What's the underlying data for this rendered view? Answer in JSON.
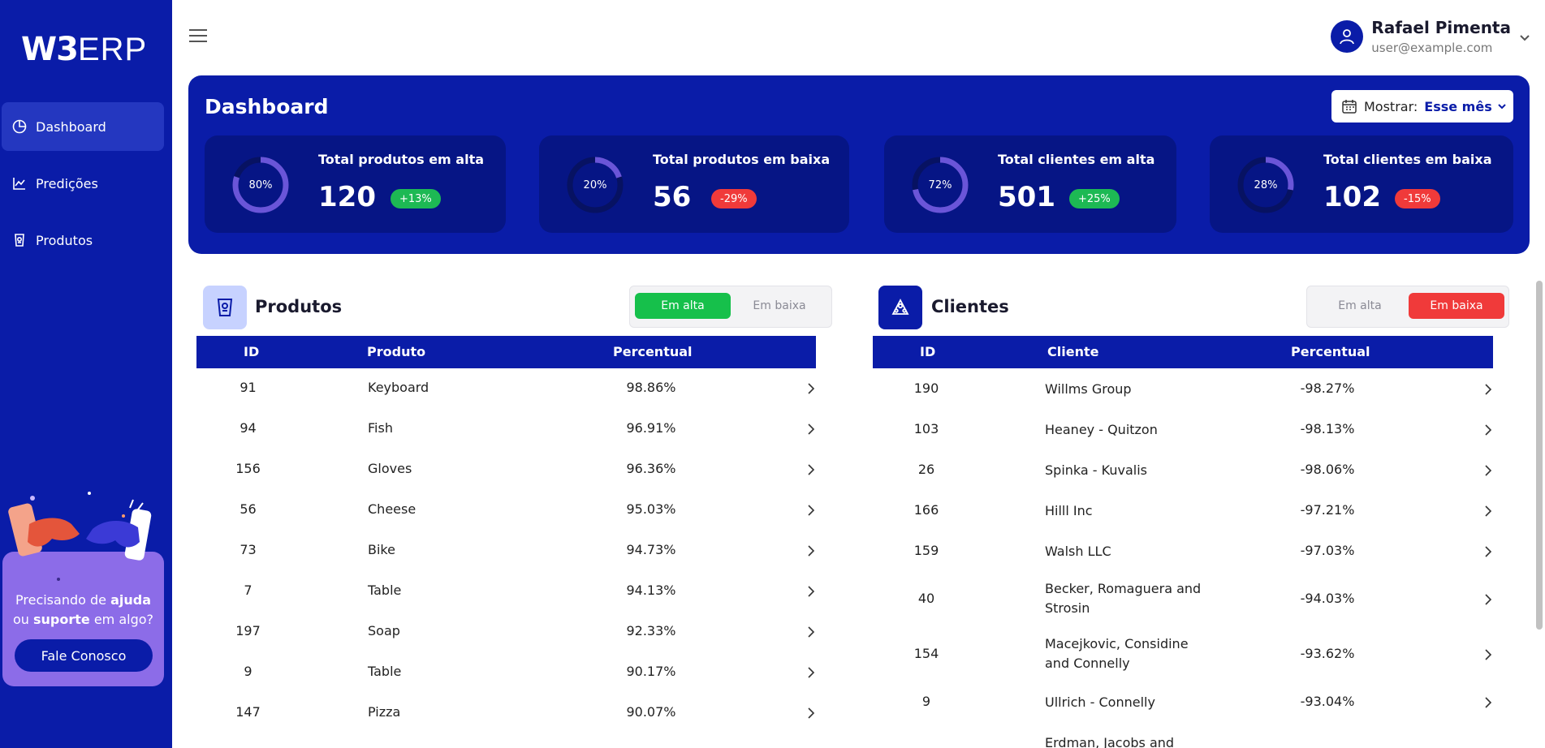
{
  "logo": {
    "w3": "W3",
    "erp": "ERP"
  },
  "sidebar": {
    "items": [
      {
        "label": "Dashboard",
        "icon": "pie-chart-icon",
        "active": true
      },
      {
        "label": "Predições",
        "icon": "line-chart-icon",
        "active": false
      },
      {
        "label": "Produtos",
        "icon": "product-icon",
        "active": false
      }
    ],
    "help": {
      "line1_pre": "Precisando de ",
      "line1_bold": "ajuda",
      "line2_pre": "ou ",
      "line2_bold": "suporte",
      "line2_post": " em algo?",
      "button": "Fale Conosco"
    }
  },
  "user": {
    "name": "Rafael Pimenta",
    "email": "user@example.com"
  },
  "dashboard": {
    "title": "Dashboard",
    "filter": {
      "label": "Mostrar:",
      "value": "Esse mês"
    },
    "stats": [
      {
        "title": "Total produtos em alta",
        "value": "120",
        "badge": "+13%",
        "trend": "up",
        "percent": 80,
        "percent_label": "80%"
      },
      {
        "title": "Total produtos em baixa",
        "value": "56",
        "badge": "-29%",
        "trend": "down",
        "percent": 20,
        "percent_label": "20%"
      },
      {
        "title": "Total clientes em alta",
        "value": "501",
        "badge": "+25%",
        "trend": "up",
        "percent": 72,
        "percent_label": "72%"
      },
      {
        "title": "Total clientes em baixa",
        "value": "102",
        "badge": "-15%",
        "trend": "down",
        "percent": 28,
        "percent_label": "28%"
      }
    ]
  },
  "produtos": {
    "title": "Produtos",
    "toggle": {
      "alta": "Em alta",
      "baixa": "Em baixa",
      "selected": "alta"
    },
    "columns": [
      "ID",
      "Produto",
      "Percentual"
    ],
    "rows": [
      {
        "id": "91",
        "name": "Keyboard",
        "pct": "98.86%"
      },
      {
        "id": "94",
        "name": "Fish",
        "pct": "96.91%"
      },
      {
        "id": "156",
        "name": "Gloves",
        "pct": "96.36%"
      },
      {
        "id": "56",
        "name": "Cheese",
        "pct": "95.03%"
      },
      {
        "id": "73",
        "name": "Bike",
        "pct": "94.73%"
      },
      {
        "id": "7",
        "name": "Table",
        "pct": "94.13%"
      },
      {
        "id": "197",
        "name": "Soap",
        "pct": "92.33%"
      },
      {
        "id": "9",
        "name": "Table",
        "pct": "90.17%"
      },
      {
        "id": "147",
        "name": "Pizza",
        "pct": "90.07%"
      }
    ]
  },
  "clientes": {
    "title": "Clientes",
    "toggle": {
      "alta": "Em alta",
      "baixa": "Em baixa",
      "selected": "baixa"
    },
    "columns": [
      "ID",
      "Cliente",
      "Percentual"
    ],
    "rows": [
      {
        "id": "190",
        "name1": "Willms Group",
        "name2": "",
        "pct": "-98.27%"
      },
      {
        "id": "103",
        "name1": "Heaney - Quitzon",
        "name2": "",
        "pct": "-98.13%"
      },
      {
        "id": "26",
        "name1": "Spinka - Kuvalis",
        "name2": "",
        "pct": "-98.06%"
      },
      {
        "id": "166",
        "name1": "Hilll Inc",
        "name2": "",
        "pct": "-97.21%"
      },
      {
        "id": "159",
        "name1": "Walsh LLC",
        "name2": "",
        "pct": "-97.03%"
      },
      {
        "id": "40",
        "name1": "Becker, Romaguera and",
        "name2": "Strosin",
        "pct": "-94.03%"
      },
      {
        "id": "154",
        "name1": "Macejkovic, Considine",
        "name2": "and Connelly",
        "pct": "-93.62%"
      },
      {
        "id": "9",
        "name1": "Ullrich - Connelly",
        "name2": "",
        "pct": "-93.04%"
      },
      {
        "id": "",
        "name1": "Erdman, Jacobs and",
        "name2": "",
        "pct": ""
      }
    ]
  }
}
